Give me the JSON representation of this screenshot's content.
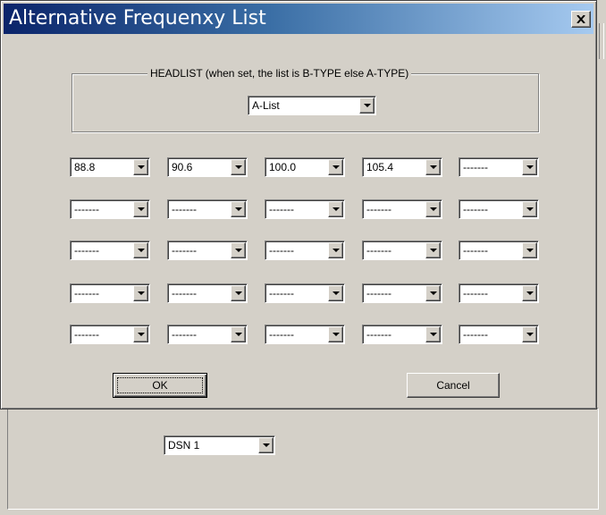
{
  "dialog": {
    "title": "Alternative Frequenxy List",
    "close_icon": "close-icon",
    "headlist": {
      "label": "HEADLIST (when set, the list is B-TYPE else A-TYPE)",
      "selected": "A-List"
    },
    "frequencies": [
      [
        "88.8",
        "90.6",
        "100.0",
        "105.4",
        "-------"
      ],
      [
        "-------",
        "-------",
        "-------",
        "-------",
        "-------"
      ],
      [
        "-------",
        "-------",
        "-------",
        "-------",
        "-------"
      ],
      [
        "-------",
        "-------",
        "-------",
        "-------",
        "-------"
      ],
      [
        "-------",
        "-------",
        "-------",
        "-------",
        "-------"
      ]
    ],
    "ok_label": "OK",
    "cancel_label": "Cancel"
  },
  "background": {
    "dsn_selected": "DSN 1"
  },
  "colors": {
    "face": "#d4d0c8",
    "title_start": "#0a246a",
    "title_end": "#a6caf0"
  }
}
